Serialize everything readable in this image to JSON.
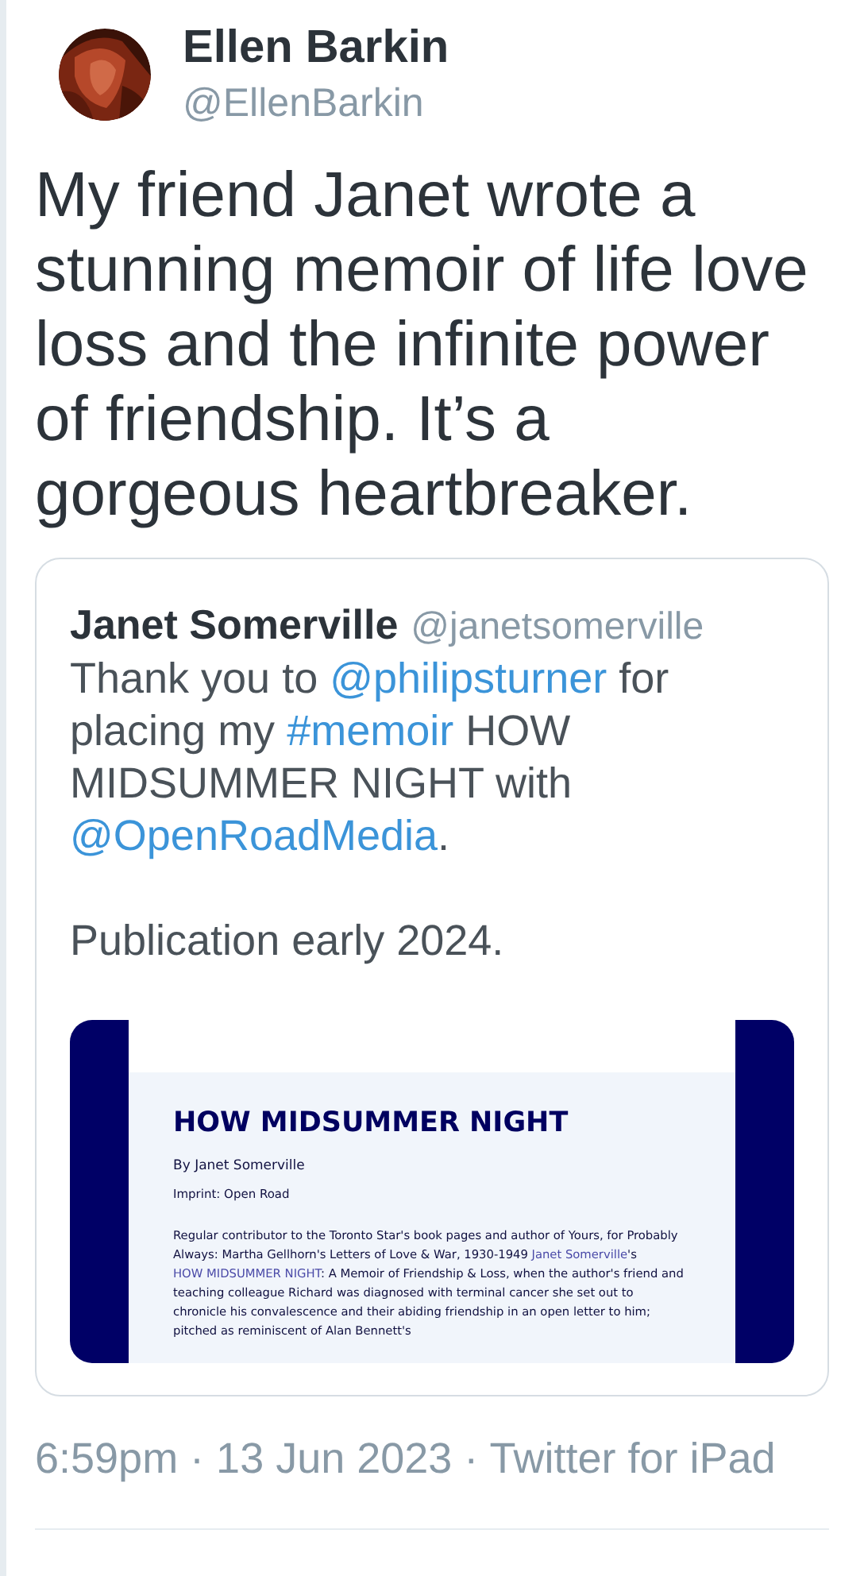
{
  "author": {
    "name": "Ellen Barkin",
    "handle": "@EllenBarkin"
  },
  "text": "My friend Janet wrote a stunning memoir of life love loss and the infinite power of friendship. It’s a gorgeous heartbreaker.",
  "quote": {
    "name": "Janet Somerville",
    "handle": "@janetsomerville",
    "paragraphs": [
      [
        {
          "kind": "text",
          "text": "Thank you to "
        },
        {
          "kind": "link",
          "text": "@philipsturner"
        },
        {
          "kind": "text",
          "text": " for placing my "
        },
        {
          "kind": "link",
          "text": "#memoir"
        },
        {
          "kind": "text",
          "text": " HOW MIDSUMMER NIGHT with "
        },
        {
          "kind": "link",
          "text": "@OpenRoadMedia"
        },
        {
          "kind": "text",
          "text": "."
        }
      ],
      [
        {
          "kind": "text",
          "text": "Publication early 2024."
        }
      ]
    ],
    "document": {
      "title": "HOW MIDSUMMER NIGHT",
      "byline": "By Janet Somerville",
      "imprint": "Imprint: Open Road",
      "body": [
        {
          "kind": "text",
          "text": "Regular contributor to the Toronto Star's book pages and author of Yours, for Probably Always: Martha Gellhorn's Letters of Love & War, 1930-1949 "
        },
        {
          "kind": "link",
          "text": "Janet Somerville"
        },
        {
          "kind": "text",
          "text": "'s "
        },
        {
          "kind": "link",
          "text": "HOW MIDSUMMER NIGHT"
        },
        {
          "kind": "text",
          "text": ": A Memoir of Friendship & Loss, when the author's friend and teaching colleague Richard was diagnosed with terminal cancer she set out to chronicle his convalescence and their abiding friendship in an open letter to him; pitched as reminiscent of Alan Bennett's"
        }
      ]
    }
  },
  "meta": "6:59pm · 13 Jun 2023 · Twitter for iPad"
}
